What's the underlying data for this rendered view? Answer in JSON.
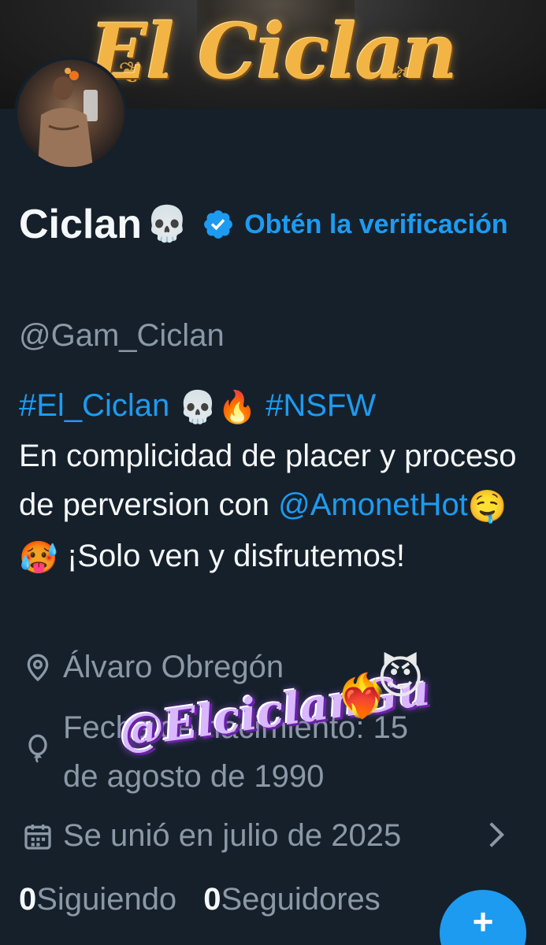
{
  "banner": {
    "logo_text": "El Ciclan"
  },
  "profile": {
    "display_name": "Ciclan",
    "name_emoji": "💀",
    "verify_link": "Obtén la verificación",
    "handle": "@Gam_Ciclan"
  },
  "bio": {
    "hashtag1": "#El_Ciclan",
    "emoji1": "💀🔥",
    "hashtag2": "#NSFW",
    "line1": "En complicidad de placer y proceso de perversion con",
    "mention": "@AmonetHot",
    "emoji2": "🤤🥵",
    "line2": "¡Solo ven y disfrutemos!"
  },
  "meta": {
    "location": "Álvaro Obregón",
    "birthday_line1": "Fecha de nacimiento: 15",
    "birthday_line2": "de agosto de 1990",
    "joined": "Se unió en julio de 2025"
  },
  "counts": {
    "following_value": "0",
    "following_label": "Siguiendo",
    "followers_value": "0",
    "followers_label": "Seguidores"
  },
  "watermark": {
    "text": "@ElciclanGu",
    "emoji_heart": "❤️‍🔥",
    "emoji_devil": "😈"
  },
  "fab": {
    "symbol": "+"
  },
  "colors": {
    "background": "#15202b",
    "accent": "#1d9bf0",
    "muted": "#8b98a5"
  },
  "icons": [
    "verified-badge-icon",
    "location-pin-icon",
    "balloon-icon",
    "calendar-icon",
    "chevron-right-icon",
    "plus-icon"
  ]
}
